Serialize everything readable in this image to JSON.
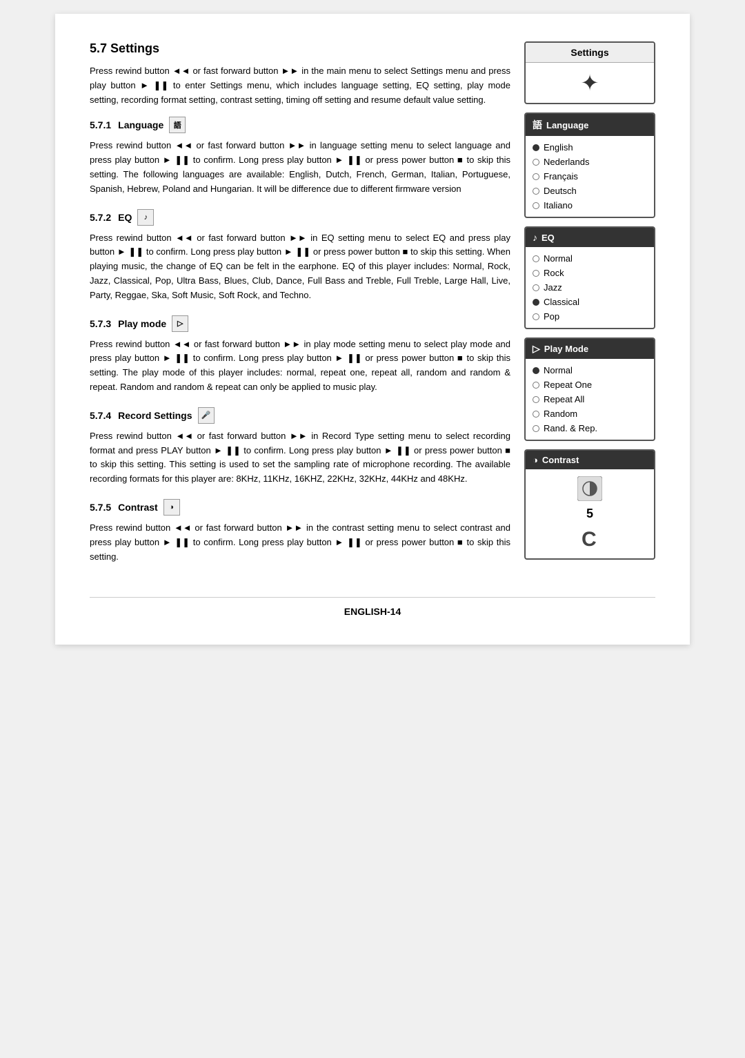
{
  "page": {
    "footer": "ENGLISH-14"
  },
  "section": {
    "number": "5.7",
    "title": "Settings",
    "intro": "Press rewind button ◄◄ or fast forward button ►► in the main menu to select Settings menu and press play button ► ❚❚ to enter Settings menu, which includes language setting, EQ setting, play mode setting, recording format setting, contrast setting, timing off setting and resume default value setting."
  },
  "subsections": {
    "s571": {
      "number": "5.7.1",
      "title": "Language",
      "body": "Press rewind button ◄◄ or fast forward button ►► in language setting menu to select language and press play button ► ❚❚ to confirm. Long press play button ► ❚❚ or press power button ■ to skip this setting. The following languages are available: English, Dutch, French, German, Italian, Portuguese, Spanish, Hebrew, Poland and Hungarian. It will be difference due to different firmware version"
    },
    "s572": {
      "number": "5.7.2",
      "title": "EQ",
      "body": "Press rewind button ◄◄ or fast forward button ►► in EQ setting menu to select EQ and press play button ► ❚❚ to confirm. Long press play button ► ❚❚ or press power button ■ to skip this setting. When playing music, the change of EQ can be felt in the earphone. EQ of this player includes: Normal, Rock, Jazz, Classical, Pop, Ultra Bass, Blues, Club, Dance, Full Bass and Treble, Full Treble, Large Hall, Live, Party, Reggae, Ska, Soft Music, Soft Rock, and Techno."
    },
    "s573": {
      "number": "5.7.3",
      "title": "Play mode",
      "body": "Press rewind button ◄◄ or fast forward button ►► in play mode setting menu to select play mode and press play button ► ❚❚ to confirm. Long press play button ► ❚❚ or press power button ■ to skip this setting. The play mode of this player includes: normal, repeat one, repeat all, random and random & repeat. Random and random & repeat can only be applied to music play."
    },
    "s574": {
      "number": "5.7.4",
      "title": "Record Settings",
      "body": "Press rewind button ◄◄ or fast forward button ►► in Record Type setting menu to select recording format and press PLAY button ► ❚❚ to confirm. Long press play button ► ❚❚ or press power button ■ to skip this setting. This setting is used to set the sampling rate of microphone recording. The available recording formats for this player are: 8KHz, 11KHz, 16KHZ, 22KHz, 32KHz, 44KHz and 48KHz."
    },
    "s575": {
      "number": "5.7.5",
      "title": "Contrast",
      "body": "Press rewind button ◄◄ or fast forward button ►► in the contrast setting menu to select contrast and press play button ► ❚❚ to confirm. Long press play button ► ❚❚ or press power button ■ to skip this setting."
    }
  },
  "panels": {
    "settings": {
      "title": "Settings"
    },
    "language": {
      "title": "Language",
      "items": [
        {
          "label": "English",
          "selected": true
        },
        {
          "label": "Nederlands",
          "selected": false
        },
        {
          "label": "Français",
          "selected": false
        },
        {
          "label": "Deutsch",
          "selected": false
        },
        {
          "label": "Italiano",
          "selected": false
        }
      ]
    },
    "eq": {
      "title": "EQ",
      "items": [
        {
          "label": "Normal",
          "selected": false
        },
        {
          "label": "Rock",
          "selected": false
        },
        {
          "label": "Jazz",
          "selected": false
        },
        {
          "label": "Classical",
          "selected": true
        },
        {
          "label": "Pop",
          "selected": false
        }
      ]
    },
    "playmode": {
      "title": "Play Mode",
      "items": [
        {
          "label": "Normal",
          "selected": true
        },
        {
          "label": "Repeat One",
          "selected": false
        },
        {
          "label": "Repeat All",
          "selected": false
        },
        {
          "label": "Random",
          "selected": false
        },
        {
          "label": "Rand. & Rep.",
          "selected": false
        }
      ]
    },
    "contrast": {
      "title": "Contrast",
      "value": "5"
    }
  }
}
